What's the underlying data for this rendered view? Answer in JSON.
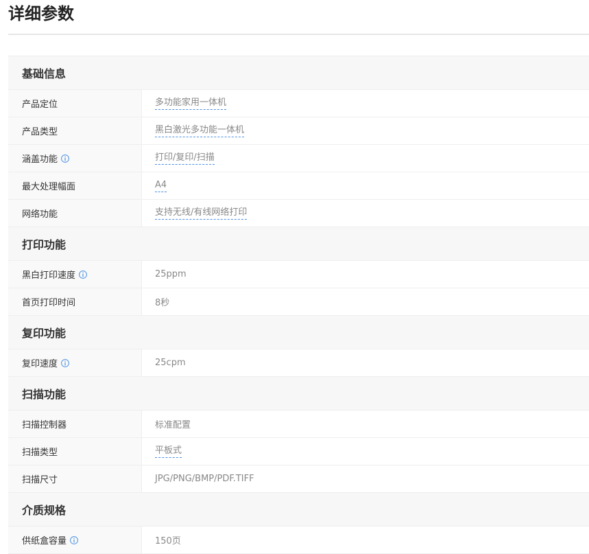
{
  "page_title": "详细参数",
  "colors": {
    "link_underline": "#4a90e2",
    "info_icon": "#4a90e2"
  },
  "sections": [
    {
      "title": "基础信息",
      "rows": [
        {
          "label": "产品定位",
          "value": "多功能家用一体机",
          "link": true,
          "info": false
        },
        {
          "label": "产品类型",
          "value": "黑白激光多功能一体机",
          "link": true,
          "info": false
        },
        {
          "label": "涵盖功能",
          "value": "打印/复印/扫描",
          "link": true,
          "info": true
        },
        {
          "label": "最大处理幅面",
          "value": "A4",
          "link": true,
          "info": false
        },
        {
          "label": "网络功能",
          "value": "支持无线/有线网络打印",
          "link": true,
          "info": false
        }
      ]
    },
    {
      "title": "打印功能",
      "rows": [
        {
          "label": "黑白打印速度",
          "value": "25ppm",
          "link": false,
          "info": true
        },
        {
          "label": "首页打印时间",
          "value": "8秒",
          "link": false,
          "info": false
        }
      ]
    },
    {
      "title": "复印功能",
      "rows": [
        {
          "label": "复印速度",
          "value": "25cpm",
          "link": false,
          "info": true
        }
      ]
    },
    {
      "title": "扫描功能",
      "rows": [
        {
          "label": "扫描控制器",
          "value": "标准配置",
          "link": false,
          "info": false
        },
        {
          "label": "扫描类型",
          "value": "平板式",
          "link": true,
          "info": false
        },
        {
          "label": "扫描尺寸",
          "value": "JPG/PNG/BMP/PDF.TIFF",
          "link": false,
          "info": false
        }
      ]
    },
    {
      "title": "介质规格",
      "rows": [
        {
          "label": "供纸盒容量",
          "value": "150页",
          "link": false,
          "info": true
        }
      ]
    }
  ]
}
